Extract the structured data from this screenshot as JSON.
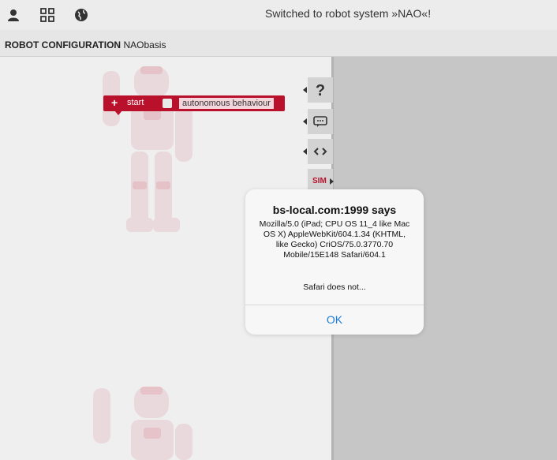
{
  "topbar": {
    "icons": [
      "user-icon",
      "grid-icon",
      "globe-icon"
    ],
    "notice": "Switched to robot system »NAO«!"
  },
  "configbar": {
    "label": "ROBOT CONFIGURATION",
    "name": "NAObasis"
  },
  "block": {
    "plus": "+",
    "start": "start",
    "option_label": "autonomous behaviour"
  },
  "tools": [
    "help-icon",
    "comment-icon",
    "code-icon"
  ],
  "sim": {
    "label": "SIM"
  },
  "dialog": {
    "title": "bs-local.com:1999 says",
    "message": "Mozilla/5.0 (iPad; CPU OS 11_4 like Mac OS X) AppleWebKit/604.1.34 (KHTML, like Gecko) CriOS/75.0.3770.70 Mobile/15E148 Safari/604.1",
    "note": "Safari does not...",
    "ok": "OK"
  },
  "colors": {
    "accent": "#b9102c",
    "link": "#1a7bd8"
  }
}
